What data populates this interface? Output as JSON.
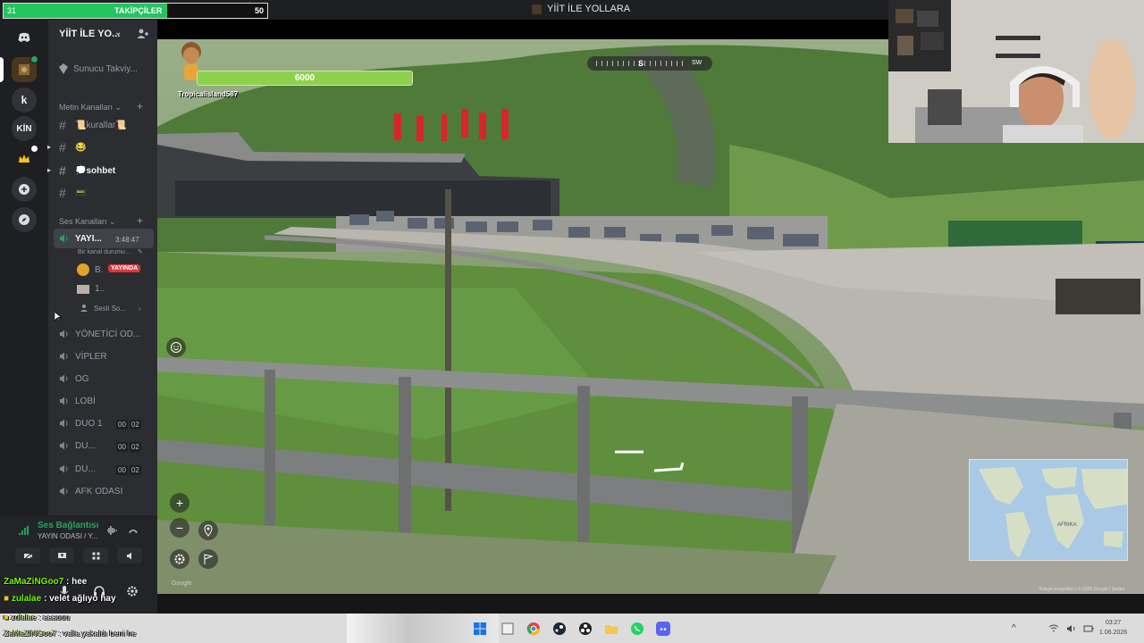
{
  "follow_goal": {
    "current": "31",
    "label": "TAKİPÇİLER",
    "goal": "50",
    "progress": 0.62
  },
  "window": {
    "title": "YİİT İLE YOLLARA"
  },
  "servers": [
    {
      "label": "",
      "icon": "discord-home-icon"
    },
    {
      "label": "",
      "icon": "server-avatar-icon"
    },
    {
      "label": "k",
      "icon": ""
    },
    {
      "label": "KİN",
      "icon": ""
    },
    {
      "label": "",
      "icon": "crown-server-icon"
    },
    {
      "label": "",
      "icon": "add-server-icon"
    },
    {
      "label": "",
      "icon": "explore-icon"
    }
  ],
  "sidebar": {
    "server_name": "YİİT İLE YO...",
    "boost_label": "Sunucu Takviy...",
    "text_category": "Metin Kanalları",
    "text_channels": [
      "📜kurallar📜",
      "😂",
      "💭sohbet",
      "📟"
    ],
    "voice_category": "Ses Kanalları",
    "active_voice": {
      "name": "YAYI...",
      "timer": "3:48:47",
      "status": "Bir kanal durumu ..."
    },
    "voice_users": [
      {
        "name": "B.",
        "badge": "YAYINDA"
      },
      {
        "name": "1..",
        "badge": ""
      }
    ],
    "soundboard": "Sesli So...",
    "voice_channels": [
      {
        "name": "YÖNETİCİ OD...",
        "counts": []
      },
      {
        "name": "VİPLER",
        "counts": []
      },
      {
        "name": "OG",
        "counts": []
      },
      {
        "name": "LOBİ",
        "counts": []
      },
      {
        "name": "DUO 1",
        "counts": [
          "00",
          "02"
        ]
      },
      {
        "name": "DU...",
        "counts": [
          "00",
          "02"
        ]
      },
      {
        "name": "DU...",
        "counts": [
          "00",
          "02"
        ]
      },
      {
        "name": "AFK ODASI",
        "counts": []
      }
    ]
  },
  "voice_panel": {
    "title": "Ses Bağlantısı",
    "subtitle": "YAYIN ODASI / Y..."
  },
  "chat": [
    {
      "user": "ZaMaZiNGoo7",
      "msg": " : hee"
    },
    {
      "user": "zulalae",
      "msg": " : velet ağlıyo hay"
    },
    {
      "user": "zulalae",
      "msg": " : aaauuu"
    },
    {
      "user": "ZaMaZiNGoo7",
      "msg": " : valla yakaldı beni he"
    }
  ],
  "game": {
    "hp_value": "6000",
    "hp_fraction": 1.0,
    "player_name": "Tropicalisland587",
    "compass_dir": "S",
    "compass_next": "SW",
    "minimap_label": "AFRIKA",
    "copyright": "Klavye kısayolları | © 2026 Google | Şartlar",
    "watermark": "Google"
  },
  "taskbar": {
    "time": "03:27",
    "date": "1.06.2026"
  },
  "colors": {
    "discord_bg": "#1e1f22",
    "sidebar_bg": "#2b2d31",
    "accent_green": "#23a55a",
    "live_red": "#da373c",
    "follow_green": "#22c55e"
  }
}
